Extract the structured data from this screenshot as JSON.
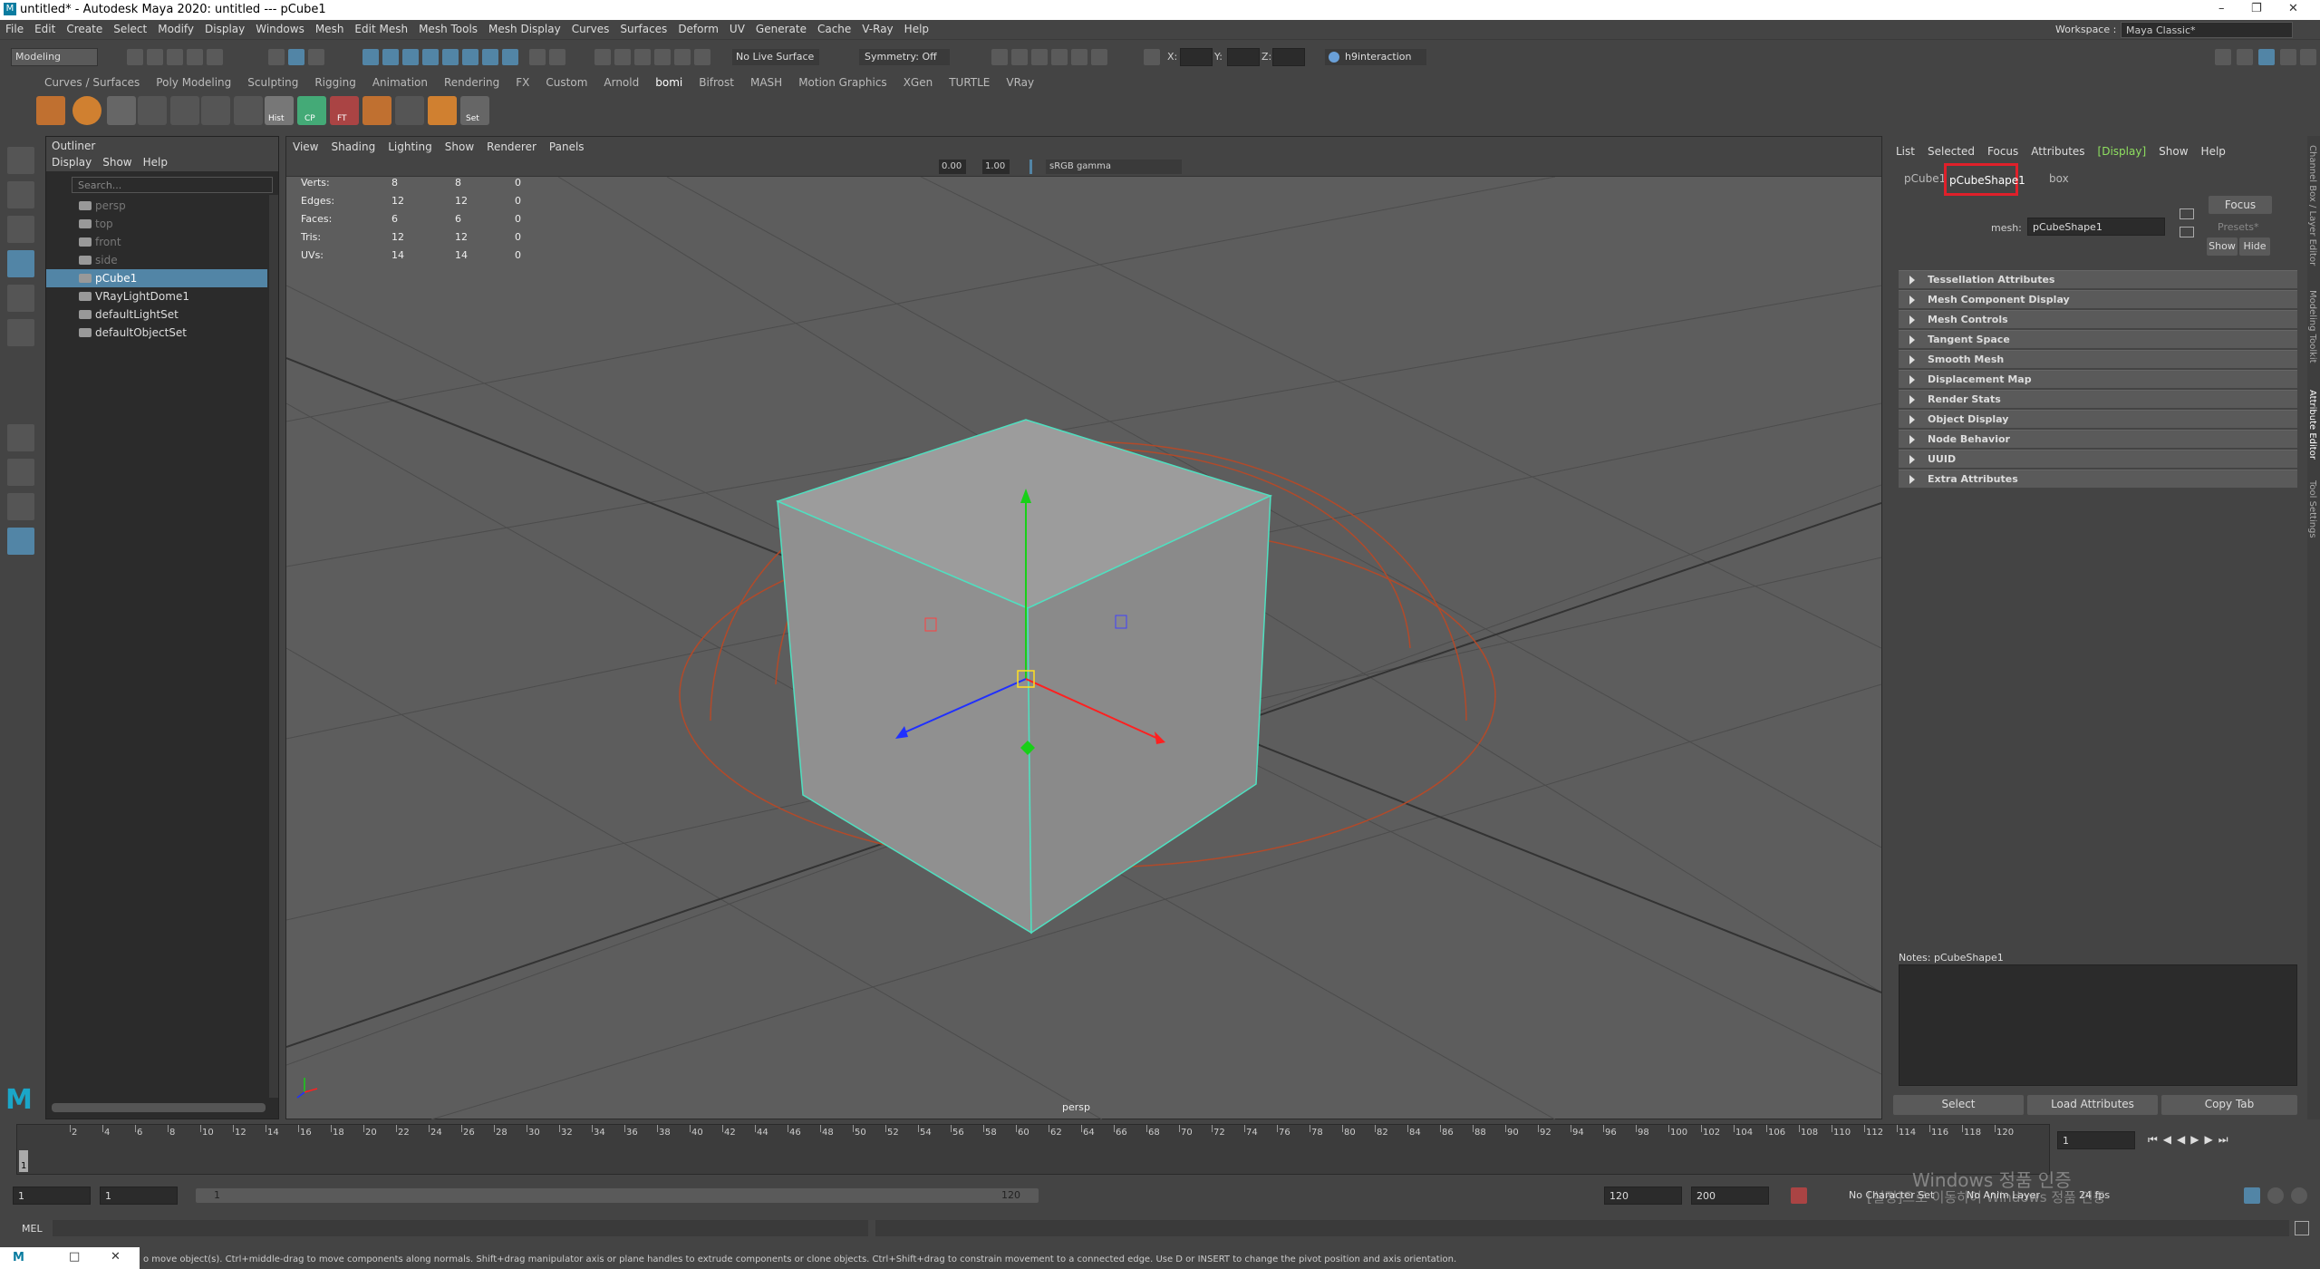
{
  "title_bar": {
    "text": "untitled* - Autodesk Maya 2020: untitled   ---   pCube1"
  },
  "menu": [
    "File",
    "Edit",
    "Create",
    "Select",
    "Modify",
    "Display",
    "Windows",
    "Mesh",
    "Edit Mesh",
    "Mesh Tools",
    "Mesh Display",
    "Curves",
    "Surfaces",
    "Deform",
    "UV",
    "Generate",
    "Cache",
    "V-Ray",
    "Help"
  ],
  "workspace": {
    "label": "Workspace :",
    "value": "Maya Classic*"
  },
  "status_line": {
    "mode": "Modeling",
    "live_surface": "No Live Surface",
    "symmetry": "Symmetry: Off",
    "x_label": "X:",
    "y_label": "Y:",
    "z_label": "Z:",
    "user": "h9interaction"
  },
  "shelf_tabs": [
    "Curves / Surfaces",
    "Poly Modeling",
    "Sculpting",
    "Rigging",
    "Animation",
    "Rendering",
    "FX",
    "Custom",
    "Arnold",
    "bomi",
    "Bifrost",
    "MASH",
    "Motion Graphics",
    "XGen",
    "TURTLE",
    "VRay"
  ],
  "shelf_active": "bomi",
  "shelf_labels": [
    "Hist",
    "CP",
    "FT",
    "Set"
  ],
  "outliner": {
    "title": "Outliner",
    "menu": [
      "Display",
      "Show",
      "Help"
    ],
    "search_placeholder": "Search...",
    "items": [
      {
        "label": "persp",
        "dim": true
      },
      {
        "label": "top",
        "dim": true
      },
      {
        "label": "front",
        "dim": true
      },
      {
        "label": "side",
        "dim": true
      },
      {
        "label": "pCube1",
        "selected": true
      },
      {
        "label": "VRayLightDome1"
      },
      {
        "label": "defaultLightSet"
      },
      {
        "label": "defaultObjectSet"
      }
    ]
  },
  "viewport": {
    "menu": [
      "View",
      "Shading",
      "Lighting",
      "Show",
      "Renderer",
      "Panels"
    ],
    "exposure": "0.00",
    "gamma": "1.00",
    "colorspace": "sRGB gamma",
    "camera": "persp",
    "hud": [
      {
        "label": "Verts:",
        "a": "8",
        "b": "8",
        "c": "0"
      },
      {
        "label": "Edges:",
        "a": "12",
        "b": "12",
        "c": "0"
      },
      {
        "label": "Faces:",
        "a": "6",
        "b": "6",
        "c": "0"
      },
      {
        "label": "Tris:",
        "a": "12",
        "b": "12",
        "c": "0"
      },
      {
        "label": "UVs:",
        "a": "14",
        "b": "14",
        "c": "0"
      }
    ]
  },
  "attribute_editor": {
    "menu": [
      "List",
      "Selected",
      "Focus",
      "Attributes",
      "[Display]",
      "Show",
      "Help"
    ],
    "tabs": [
      "pCube1",
      "pCubeShape1",
      "box"
    ],
    "active_tab": "pCubeShape1",
    "mesh_label": "mesh:",
    "mesh_value": "pCubeShape1",
    "focus": "Focus",
    "presets": "Presets*",
    "show": "Show",
    "hide": "Hide",
    "sections": [
      "Tessellation Attributes",
      "Mesh Component Display",
      "Mesh Controls",
      "Tangent Space",
      "Smooth Mesh",
      "Displacement Map",
      "Render Stats",
      "Object Display",
      "Node Behavior",
      "UUID",
      "Extra Attributes"
    ],
    "notes": "Notes:  pCubeShape1",
    "buttons": [
      "Select",
      "Load Attributes",
      "Copy Tab"
    ]
  },
  "right_tabs": [
    "Channel Box / Layer Editor",
    "Modeling Toolkit",
    "Attribute Editor",
    "Tool Settings"
  ],
  "timeline": {
    "ticks": [
      "2",
      "4",
      "6",
      "8",
      "10",
      "12",
      "14",
      "16",
      "18",
      "20",
      "22",
      "24",
      "26",
      "28",
      "30",
      "32",
      "34",
      "36",
      "38",
      "40",
      "42",
      "44",
      "46",
      "48",
      "50",
      "52",
      "54",
      "56",
      "58",
      "60",
      "62",
      "64",
      "66",
      "68",
      "70",
      "72",
      "74",
      "76",
      "78",
      "80",
      "82",
      "84",
      "86",
      "88",
      "90",
      "92",
      "94",
      "96",
      "98",
      "100",
      "102",
      "104",
      "106",
      "108",
      "110",
      "112",
      "114",
      "116",
      "118",
      "120"
    ],
    "current_frame": "1",
    "current_marker": "1"
  },
  "range": {
    "start": "1",
    "start2": "1",
    "slider_start": "1",
    "slider_end": "120",
    "end": "120",
    "end2": "200",
    "character": "No Character Set",
    "anim_layer": "No Anim Layer",
    "fps": "24 fps"
  },
  "command_line": {
    "label": "MEL"
  },
  "help_line": "o move object(s). Ctrl+middle-drag to move components along normals. Shift+drag manipulator axis or plane handles to extrude components or clone objects. Ctrl+Shift+drag to constrain movement to a connected edge. Use D or INSERT to change the pivot position and axis orientation.",
  "watermark": {
    "line1": "Windows 정품 인증",
    "line2": "[설정]으로 이동하여 Windows 정품 인증"
  },
  "colors": {
    "accent": "#5285a6",
    "highlight_box": "#e0202a",
    "wire": "#4fe0c0"
  }
}
